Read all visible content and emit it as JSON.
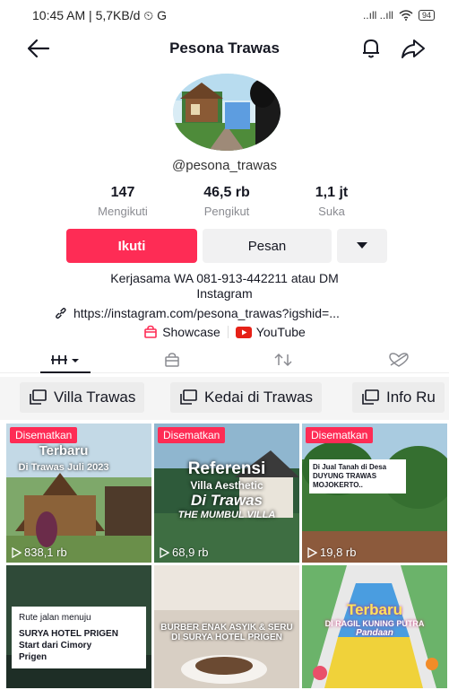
{
  "status_bar": {
    "left": "10:45 AM | 5,7KB/d ⏲ G",
    "signal": "..ıll ..ıll",
    "battery": "94"
  },
  "header": {
    "title": "Pesona Trawas"
  },
  "profile": {
    "username": "@pesona_trawas",
    "stats": [
      {
        "value": "147",
        "label": "Mengikuti"
      },
      {
        "value": "46,5 rb",
        "label": "Pengikut"
      },
      {
        "value": "1,1 jt",
        "label": "Suka"
      }
    ],
    "follow_label": "Ikuti",
    "message_label": "Pesan",
    "bio_line1": "Kerjasama WA 081-913-442211 atau DM",
    "bio_line2": "Instagram",
    "link": "https://instagram.com/pesona_trawas?igshid=...",
    "showcase_label": "Showcase",
    "youtube_label": "YouTube"
  },
  "playlists": [
    {
      "label": "Villa Trawas"
    },
    {
      "label": "Kedai di Trawas"
    },
    {
      "label": "Info Ru"
    }
  ],
  "videos": [
    {
      "pinned": "Disematkan",
      "views": "838,1 rb",
      "caption_a": "Terbaru",
      "caption_b": "Di Trawas Juli 2023"
    },
    {
      "pinned": "Disematkan",
      "views": "68,9 rb",
      "caption_a": "Referensi",
      "caption_b": "Villa Aesthetic",
      "caption_c": "Di Trawas",
      "caption_d": "THE MUMBUL VILLA"
    },
    {
      "pinned": "Disematkan",
      "views": "19,8 rb",
      "caption_a": "Di Jual Tanah di Desa",
      "caption_b": "DUYUNG TRAWAS",
      "caption_c": "MOJOKERTO.."
    },
    {
      "caption_a": "Rute jalan menuju",
      "caption_b": "SURYA HOTEL PRIGEN",
      "caption_c": "Start dari Cimory",
      "caption_d": "Prigen"
    },
    {
      "caption_a": "BURBER ENAK ASYIK & SERU",
      "caption_b": "DI SURYA HOTEL PRIGEN"
    },
    {
      "caption_a": "Terbaru",
      "caption_b": "DI RAGIL KUNING PUTRA",
      "caption_c": "Pandaan"
    }
  ],
  "colors": {
    "accent": "#fe2c55",
    "text": "#161823",
    "muted": "#8a8b91"
  }
}
